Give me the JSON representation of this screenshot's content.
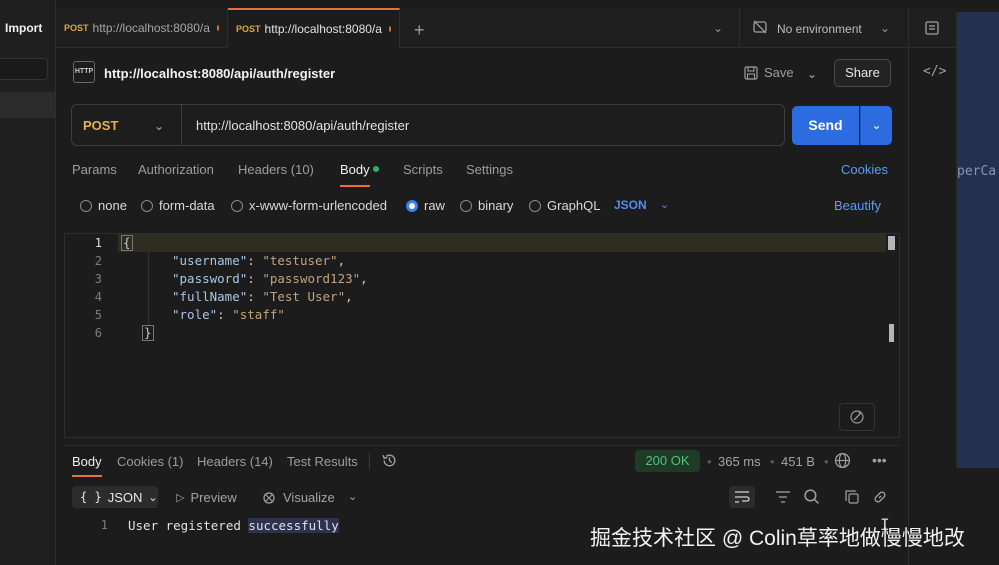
{
  "sidebar": {
    "import_label": "Import"
  },
  "tabs": [
    {
      "method": "POST",
      "url": "http://localhost:8080/a"
    },
    {
      "method": "POST",
      "url": "http://localhost:8080/a"
    }
  ],
  "environment": {
    "label": "No environment"
  },
  "request": {
    "title": "http://localhost:8080/api/auth/register",
    "save_label": "Save",
    "share_label": "Share",
    "method": "POST",
    "url": "http://localhost:8080/api/auth/register",
    "send_label": "Send"
  },
  "request_tabs": {
    "params": "Params",
    "authorization": "Authorization",
    "headers": "Headers",
    "headers_count": "(10)",
    "body": "Body",
    "scripts": "Scripts",
    "settings": "Settings",
    "cookies": "Cookies"
  },
  "body_types": {
    "none": "none",
    "form_data": "form-data",
    "urlencoded": "x-www-form-urlencoded",
    "raw": "raw",
    "binary": "binary",
    "graphql": "GraphQL",
    "format": "JSON",
    "beautify": "Beautify",
    "selected": "raw"
  },
  "editor": {
    "line_numbers": [
      "1",
      "2",
      "3",
      "4",
      "5",
      "6"
    ],
    "open_brace": "{",
    "close_brace": "}",
    "fields": [
      {
        "key": "\"username\"",
        "value": "\"testuser\""
      },
      {
        "key": "\"password\"",
        "value": "\"password123\""
      },
      {
        "key": "\"fullName\"",
        "value": "\"Test User\""
      },
      {
        "key": "\"role\"",
        "value": "\"staff\""
      }
    ]
  },
  "response": {
    "tabs": {
      "body": "Body",
      "cookies": "Cookies (1)",
      "headers": "Headers (14)",
      "tests": "Test Results"
    },
    "status": "200 OK",
    "time": "365 ms",
    "size": "451 B",
    "format": "JSON",
    "preview": "Preview",
    "visualize": "Visualize",
    "line_number": "1",
    "text_plain": "User registered ",
    "text_highlight": "successfully"
  },
  "background_window": {
    "text": "perCa"
  },
  "watermark": "掘金技术社区 @ Colin草率地做慢慢地改",
  "colors": {
    "accent": "#e8703a",
    "send": "#2c6be0",
    "method_post": "#e7b14f",
    "status_ok": "#4cc477",
    "link": "#5c9cf5"
  }
}
